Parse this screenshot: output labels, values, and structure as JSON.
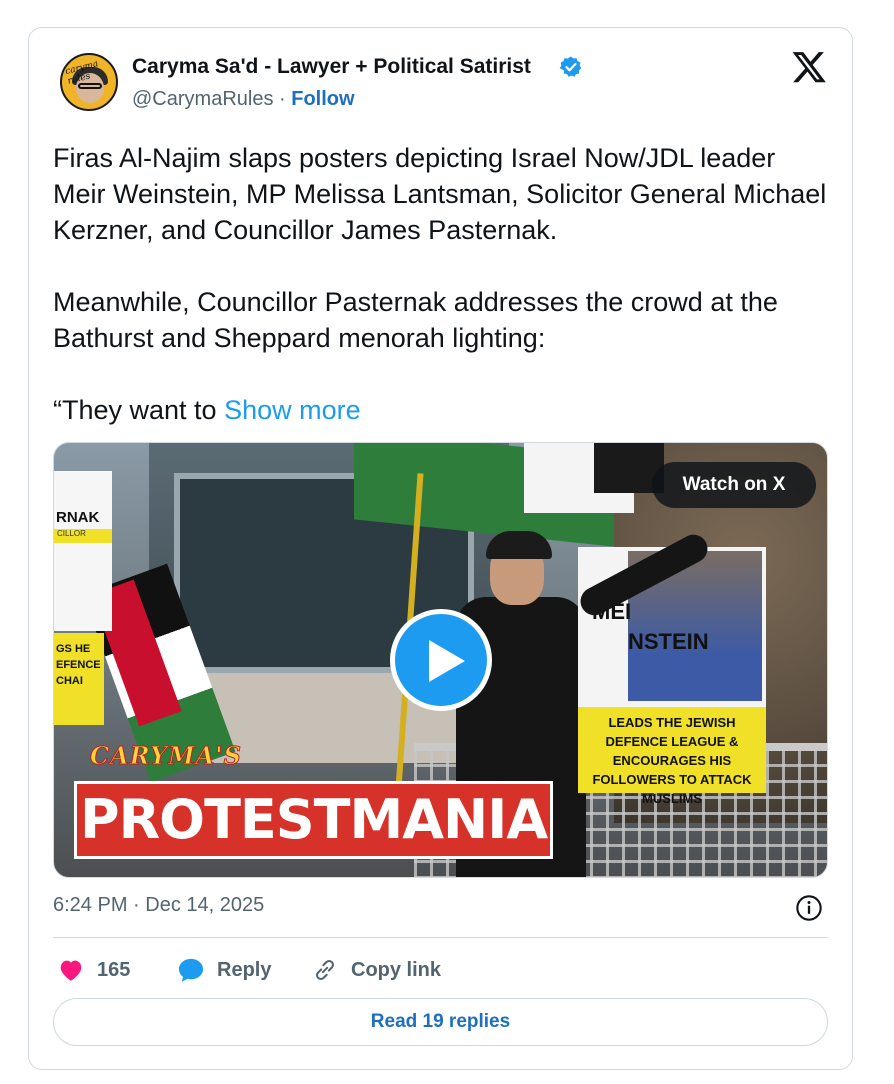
{
  "author": {
    "name": "Caryma Sa'd - Lawyer + Political Satirist",
    "handle": "@CarymaRules",
    "separator": " · ",
    "follow_label": "Follow",
    "avatar_brand_text": "caryma rules"
  },
  "tweet": {
    "paragraphs": [
      "Firas Al-Najim slaps posters depicting Israel Now/JDL leader Meir Weinstein, MP Melissa Lantsman, Solicitor General Michael Kerzner, and Councillor James Pasternak.",
      "Meanwhile, Councillor Pasternak addresses the crowd at the Bathurst and Sheppard menorah lighting:"
    ],
    "truncated_text": "“They want to ",
    "show_more_label": "Show more"
  },
  "media": {
    "watch_label": "Watch on X",
    "overlay_title_1": "CARYMA'S",
    "overlay_title_2": "PROTESTMANIA",
    "sign_left_top": "RNAK",
    "sign_left_bar": "CILLOR",
    "sign_left_bottom": "GS HE\nEFENCE\nCHAI",
    "poster_name_1": "MEI",
    "poster_name_2": "NSTEIN",
    "poster_caption": "LEADS THE JEWISH DEFENCE LEAGUE & ENCOURAGES HIS FOLLOWERS TO ATTACK MUSLIMS"
  },
  "footer": {
    "timestamp": "6:24 PM · Dec 14, 2025",
    "like_count": "165",
    "reply_label": "Reply",
    "copy_link_label": "Copy link",
    "read_replies_label": "Read 19 replies"
  },
  "colors": {
    "accent": "#1d9bf0",
    "link": "#1d6fbf",
    "like": "#f91880",
    "muted": "#536471",
    "border": "#cfd9de"
  },
  "icons": {
    "verified": "verified-badge-icon",
    "x_logo": "x-logo-icon",
    "play": "play-icon",
    "info": "info-icon",
    "like": "heart-icon",
    "reply": "speech-bubble-icon",
    "copy": "link-icon"
  }
}
